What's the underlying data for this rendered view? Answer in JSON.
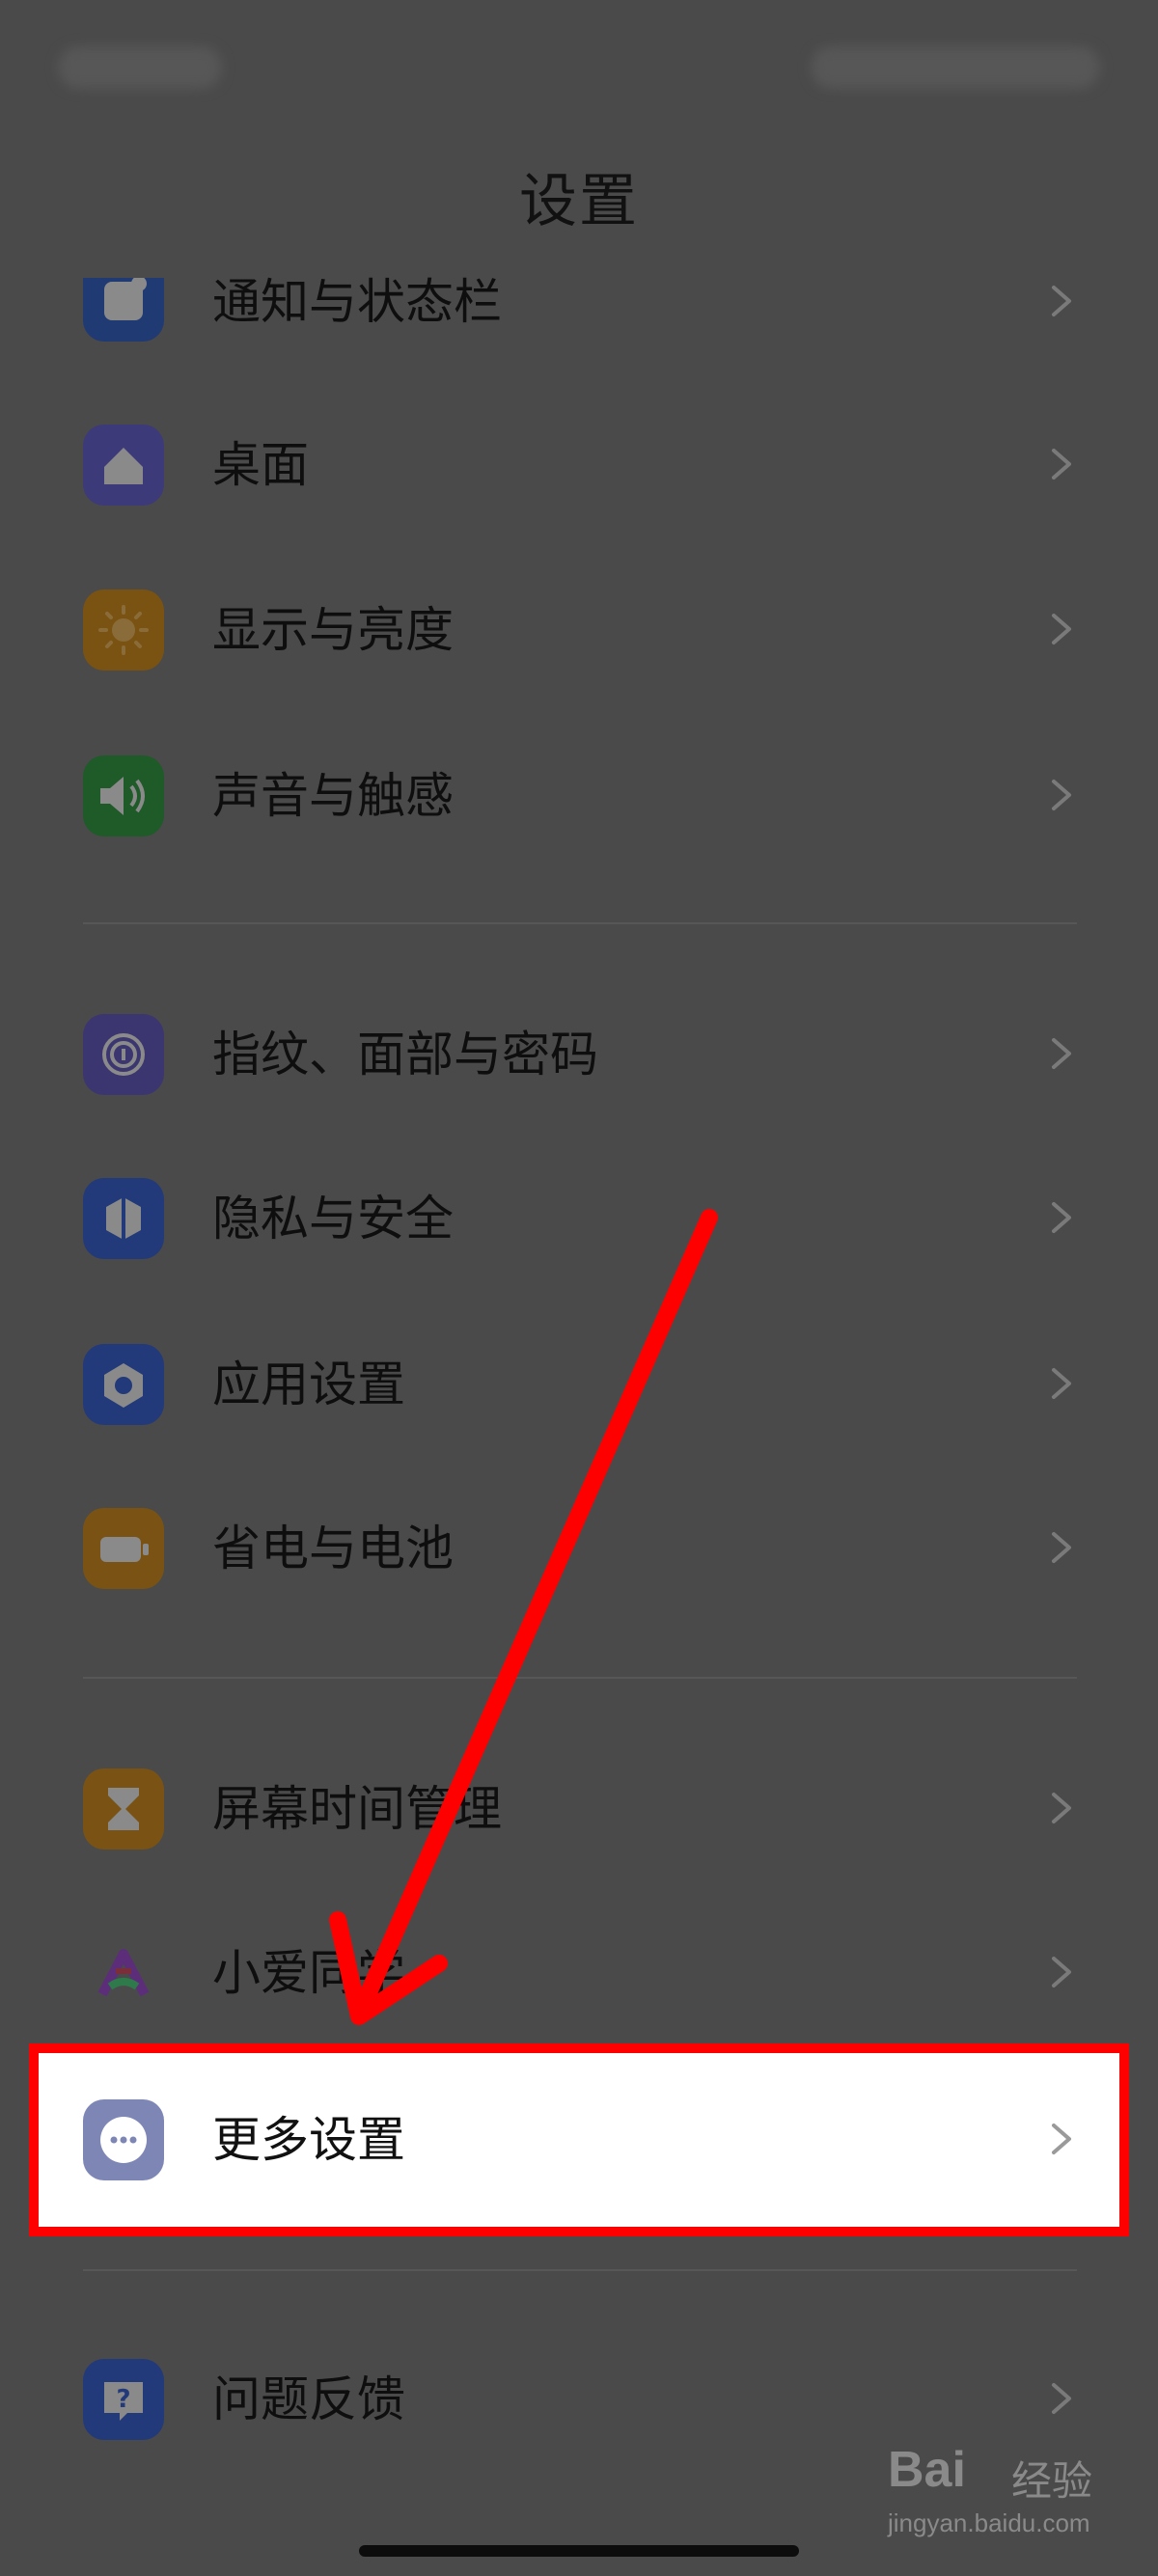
{
  "header": {
    "title": "设置"
  },
  "groups": [
    {
      "items": [
        {
          "label": "通知与状态栏",
          "icon": "notification-icon"
        },
        {
          "label": "桌面",
          "icon": "home-icon"
        },
        {
          "label": "显示与亮度",
          "icon": "sun-icon"
        },
        {
          "label": "声音与触感",
          "icon": "speaker-icon"
        }
      ]
    },
    {
      "items": [
        {
          "label": "指纹、面部与密码",
          "icon": "fingerprint-icon"
        },
        {
          "label": "隐私与安全",
          "icon": "shield-icon"
        },
        {
          "label": "应用设置",
          "icon": "hexagon-gear-icon"
        },
        {
          "label": "省电与电池",
          "icon": "battery-icon"
        }
      ]
    },
    {
      "items": [
        {
          "label": "屏幕时间管理",
          "icon": "hourglass-icon"
        },
        {
          "label": "小爱同学",
          "icon": "xiaoai-icon"
        },
        {
          "label": "更多设置",
          "icon": "more-dots-icon"
        }
      ]
    },
    {
      "items": [
        {
          "label": "问题反馈",
          "icon": "feedback-icon"
        }
      ]
    }
  ],
  "watermark": {
    "brand": "Bai",
    "brand2": "经验",
    "url": "jingyan.baidu.com"
  },
  "colors": {
    "highlight": "#ff0000",
    "arrow": "#ff0000"
  }
}
